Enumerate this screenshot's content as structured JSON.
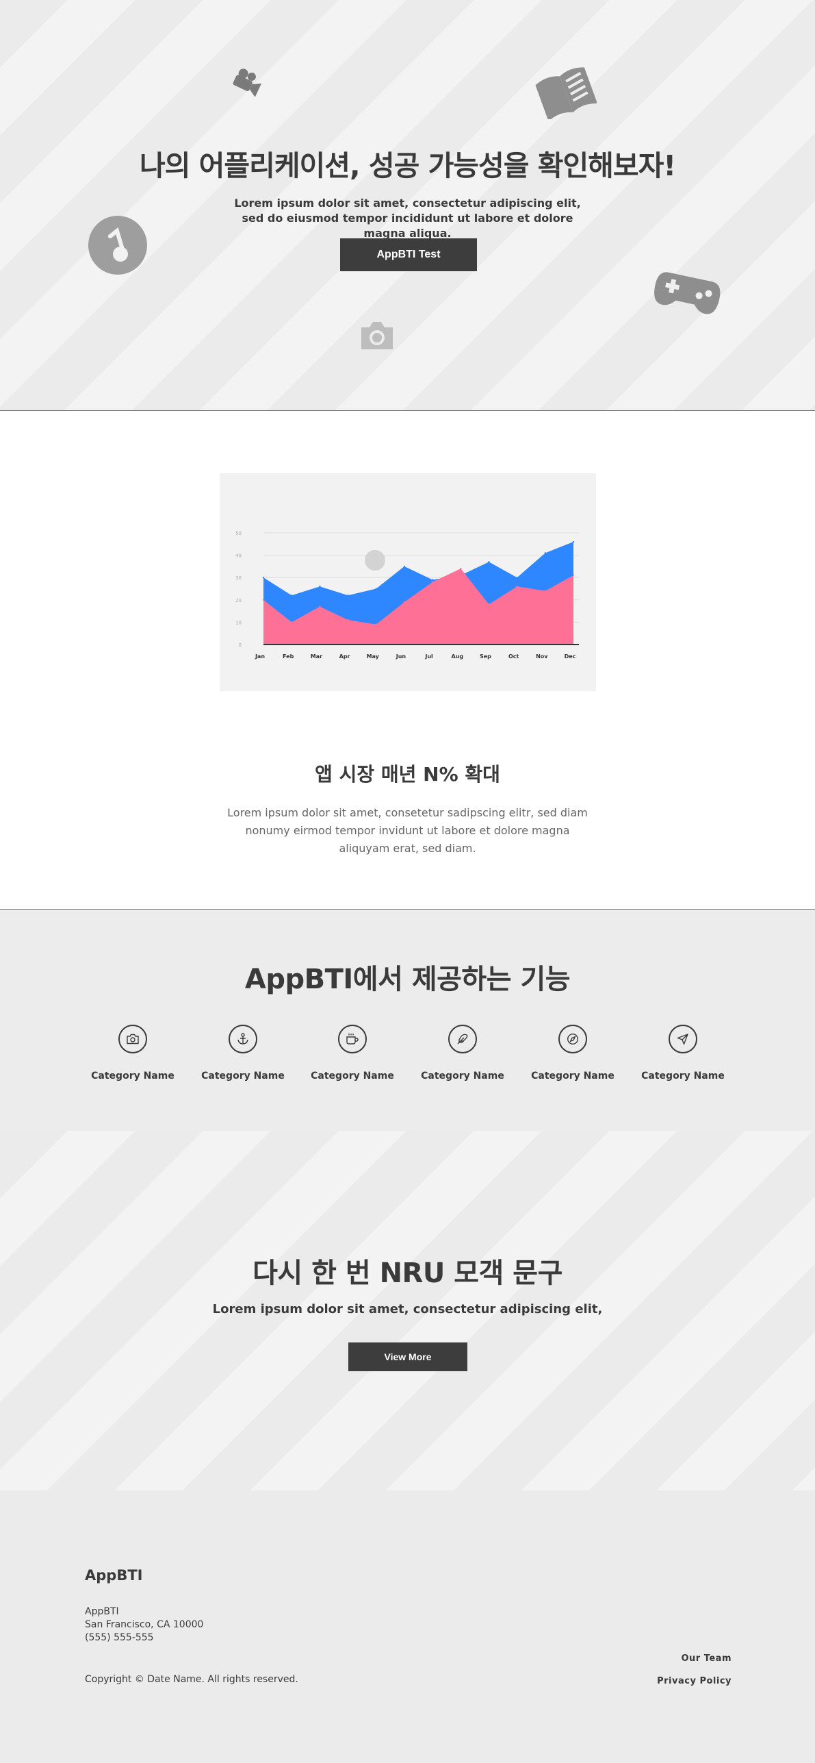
{
  "hero": {
    "title": "나의 어플리케이션, 성공 가능성을 확인해보자!",
    "subtitle": "Lorem ipsum dolor sit amet, consectetur adipiscing elit, sed do eiusmod tempor incididunt ut labore et dolore magna aliqua.",
    "button_label": "AppBTI Test",
    "icons": [
      "video-camera-icon",
      "book-icon",
      "music-note-icon",
      "gamepad-icon",
      "camera-icon"
    ]
  },
  "market": {
    "heading": "앱 시장 매년 N% 확대",
    "body": "Lorem ipsum dolor sit amet, consetetur sadipscing elitr, sed diam nonumy eirmod tempor invidunt ut labore et dolore magna aliquyam erat, sed diam."
  },
  "chart_data": {
    "type": "area",
    "categories": [
      "Jan",
      "Feb",
      "Mar",
      "Apr",
      "May",
      "Jun",
      "Jul",
      "Aug",
      "Sep",
      "Oct",
      "Nov",
      "Dec"
    ],
    "series": [
      {
        "color": "#2f87ff",
        "values": [
          30,
          22,
          26,
          22,
          25,
          35,
          29,
          31,
          37,
          30,
          41,
          46
        ]
      },
      {
        "color": "#ff7097",
        "values": [
          20,
          10,
          17,
          11,
          9,
          19,
          28,
          34,
          18,
          26,
          24,
          31
        ]
      }
    ],
    "yticks": [
      "0",
      "10",
      "20",
      "30",
      "40",
      "50"
    ],
    "ylim": [
      0,
      50
    ],
    "grid": true
  },
  "features": {
    "heading": "AppBTI에서 제공하는 기능",
    "items": [
      {
        "label": "Category Name",
        "icon": "camera-icon"
      },
      {
        "label": "Category Name",
        "icon": "anchor-icon"
      },
      {
        "label": "Category Name",
        "icon": "coffee-icon"
      },
      {
        "label": "Category Name",
        "icon": "feather-icon"
      },
      {
        "label": "Category Name",
        "icon": "compass-icon"
      },
      {
        "label": "Category Name",
        "icon": "send-icon"
      }
    ]
  },
  "cta": {
    "heading": "다시 한 번 NRU 모객 문구",
    "subtitle": "Lorem ipsum dolor sit amet, consectetur adipiscing elit,",
    "button_label": "View More"
  },
  "footer": {
    "brand": "AppBTI",
    "address_name": "AppBTI",
    "address_city": "San Francisco, CA 10000",
    "phone": "(555) 555-555",
    "copyright": "Copyright © Date Name. All rights reserved.",
    "link_team": "Our Team",
    "link_privacy": "Privacy Policy"
  }
}
